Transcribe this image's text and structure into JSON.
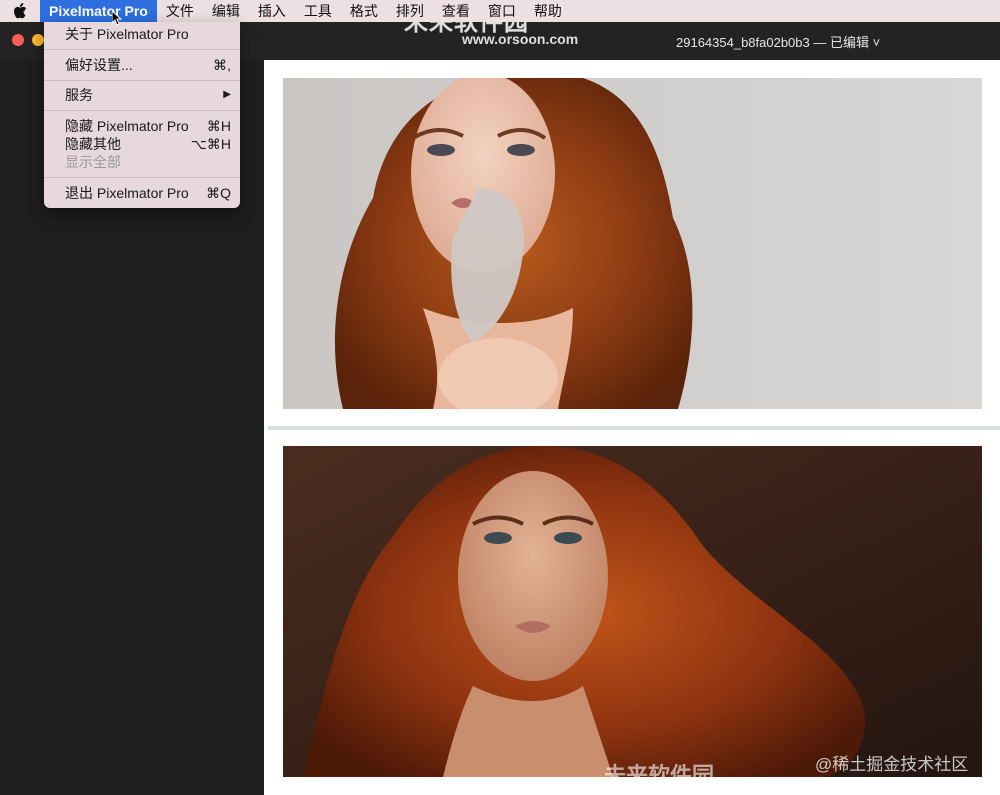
{
  "menubar": {
    "apple_icon": "apple-icon",
    "app_name": "Pixelmator Pro",
    "items": [
      "文件",
      "编辑",
      "插入",
      "工具",
      "格式",
      "排列",
      "查看",
      "窗口",
      "帮助"
    ]
  },
  "app_menu": {
    "about": "关于 Pixelmator Pro",
    "preferences": "偏好设置...",
    "preferences_shortcut": "⌘,",
    "services": "服务",
    "services_arrow": "▶",
    "hide": "隐藏 Pixelmator Pro",
    "hide_shortcut": "⌘H",
    "hide_others": "隐藏其他",
    "hide_others_shortcut": "⌥⌘H",
    "show_all": "显示全部",
    "quit": "退出 Pixelmator Pro",
    "quit_shortcut": "⌘Q"
  },
  "window": {
    "document_title": "29164354_b8fa02b0b3 — 已编辑 ˅"
  },
  "watermarks": {
    "site_name": "未来软件园",
    "site_url": "www.orsoon.com",
    "site_name_bottom": "未来软件园",
    "juejin": "@稀土掘金技术社区"
  },
  "colors": {
    "menubar_bg": "#ede0e3",
    "menu_highlight": "#2d6fe0",
    "window_bg": "#1e1e1e",
    "canvas_bg": "#ffffff"
  }
}
